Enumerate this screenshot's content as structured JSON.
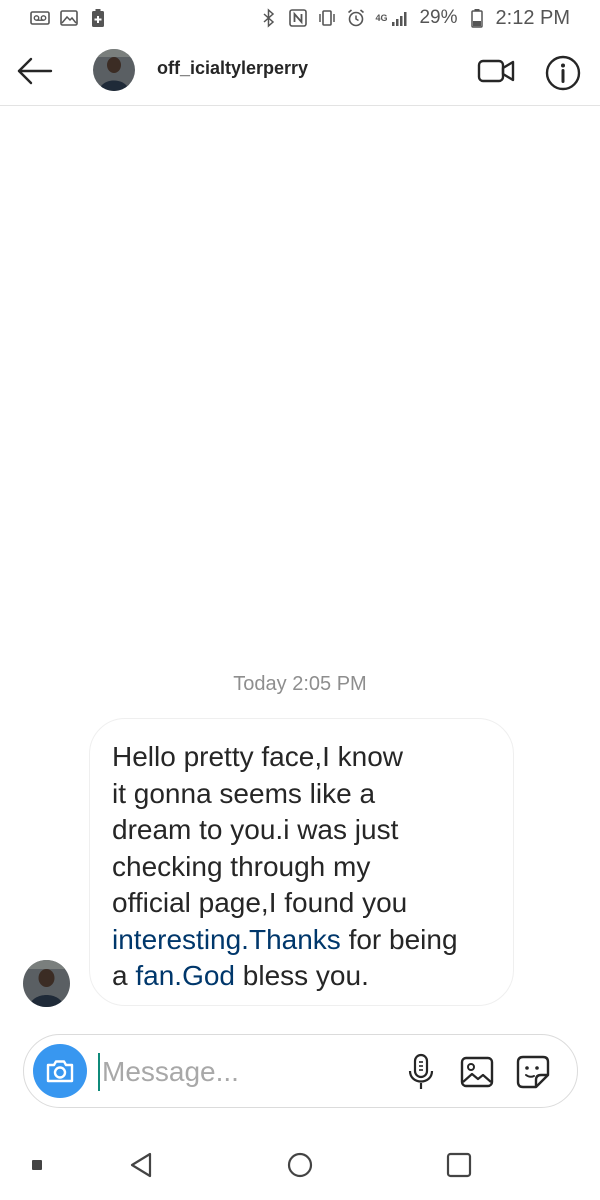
{
  "status_bar": {
    "battery_percent": "29%",
    "time": "2:12 PM",
    "network": "4G"
  },
  "header": {
    "username": "off_icialtylerperry",
    "icons": [
      "back-arrow-icon",
      "video-call-icon",
      "info-icon"
    ]
  },
  "thread": {
    "timestamp": "Today 2:05 PM",
    "message": {
      "part1": "Hello pretty face,I know\nit gonna seems like a\ndream to you.i was just\nchecking through my\nofficial page,I found you\n",
      "link1": "interesting.Thanks",
      "part2": " for being\na ",
      "link2": "fan.God",
      "part3": " bless you."
    }
  },
  "composer": {
    "placeholder": "Message...",
    "icons": [
      "camera-icon",
      "microphone-icon",
      "gallery-icon",
      "sticker-icon"
    ]
  },
  "colors": {
    "link": "#00376b",
    "camera_button": "#3897f0",
    "timestamp": "#8e8e8e"
  }
}
